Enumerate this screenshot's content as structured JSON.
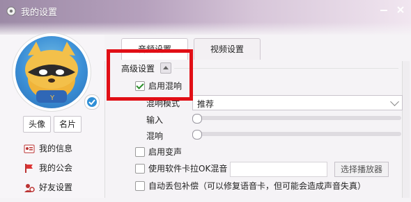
{
  "window": {
    "title": "我的设置"
  },
  "sidebar": {
    "buttons": {
      "avatar": "头像",
      "card": "名片"
    },
    "items": [
      {
        "label": "我的信息"
      },
      {
        "label": "我的公会"
      },
      {
        "label": "好友设置"
      }
    ]
  },
  "tabs": [
    {
      "label": "音频设置",
      "active": true
    },
    {
      "label": "视频设置",
      "active": false
    }
  ],
  "advanced": {
    "title": "高级设置",
    "reverb_enable": {
      "label": "启用混响",
      "checked": true
    },
    "reverb_mode": {
      "label": "混响模式",
      "value": "推荐"
    },
    "input": {
      "label": "输入",
      "value": 0
    },
    "reverb": {
      "label": "混响",
      "value": 0
    },
    "voice_change": {
      "label": "启用变声",
      "checked": false
    },
    "software_ok": {
      "label": "使用软件卡拉OK混音",
      "checked": false,
      "input_value": "",
      "button": "选择播放器"
    },
    "auto_packet": {
      "label": "自动丢包补偿（可以修复语音卡，但可能会造成声音失真）",
      "checked": false
    }
  },
  "colors": {
    "highlight": "#e10f16",
    "check": "#2a8d2a"
  }
}
